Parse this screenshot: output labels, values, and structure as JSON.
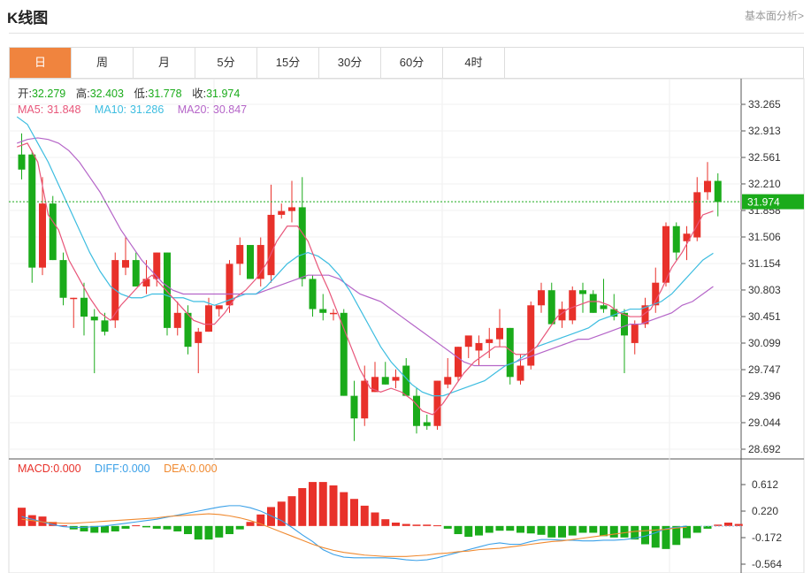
{
  "header": {
    "title": "K线图",
    "link": "基本面分析>"
  },
  "tabs": [
    "日",
    "周",
    "月",
    "5分",
    "15分",
    "30分",
    "60分",
    "4时"
  ],
  "active_tab": 0,
  "info": {
    "open_label": "开:",
    "open": "32.279",
    "high_label": "高:",
    "high": "32.403",
    "low_label": "低:",
    "low": "31.778",
    "close_label": "收:",
    "close": "31.974",
    "ma5_label": "MA5:",
    "ma5": "31.848",
    "ma10_label": "MA10:",
    "ma10": "31.286",
    "ma20_label": "MA20:",
    "ma20": "30.847"
  },
  "macd_info": {
    "macd_label": "MACD:",
    "macd": "0.000",
    "diff_label": "DIFF:",
    "diff": "0.000",
    "dea_label": "DEA:",
    "dea": "0.000"
  },
  "colors": {
    "up": "#e8312a",
    "down": "#1aab1a",
    "ma5": "#e8567a",
    "ma10": "#3dbde0",
    "ma20": "#b565c8",
    "diff": "#3aa0e8",
    "dea": "#f08a30",
    "active_tab": "#f0843e",
    "last_price": "#1aab1a"
  },
  "chart_data": [
    {
      "type": "candlestick",
      "y_ticks": [
        "33.265",
        "32.913",
        "32.561",
        "32.210",
        "31.858",
        "31.506",
        "31.154",
        "30.803",
        "30.451",
        "30.099",
        "29.747",
        "29.396",
        "29.044",
        "28.692"
      ],
      "ylim": [
        28.692,
        33.265
      ],
      "last_price": "31.974",
      "ohlc": [
        [
          32.6,
          32.88,
          32.27,
          32.4
        ],
        [
          32.6,
          32.65,
          30.9,
          31.1
        ],
        [
          31.1,
          32.3,
          31.0,
          31.95
        ],
        [
          31.95,
          32.05,
          31.2,
          31.2
        ],
        [
          31.2,
          31.3,
          30.6,
          30.7
        ],
        [
          30.7,
          30.7,
          30.3,
          30.7
        ],
        [
          30.7,
          30.9,
          30.2,
          30.45
        ],
        [
          30.45,
          30.55,
          29.7,
          30.4
        ],
        [
          30.4,
          30.5,
          30.2,
          30.25
        ],
        [
          30.4,
          31.3,
          30.3,
          31.2
        ],
        [
          31.1,
          31.5,
          31.0,
          31.2
        ],
        [
          31.2,
          31.3,
          30.85,
          30.85
        ],
        [
          30.85,
          31.2,
          30.75,
          30.95
        ],
        [
          30.95,
          31.3,
          30.85,
          31.3
        ],
        [
          31.3,
          31.3,
          30.2,
          30.3
        ],
        [
          30.3,
          30.65,
          30.2,
          30.5
        ],
        [
          30.5,
          30.6,
          29.95,
          30.05
        ],
        [
          30.1,
          30.3,
          29.7,
          30.25
        ],
        [
          30.25,
          30.7,
          30.25,
          30.6
        ],
        [
          30.55,
          30.6,
          30.45,
          30.6
        ],
        [
          30.6,
          31.2,
          30.5,
          31.15
        ],
        [
          31.15,
          31.5,
          31.0,
          31.4
        ],
        [
          31.4,
          31.4,
          30.95,
          30.95
        ],
        [
          30.95,
          31.5,
          30.85,
          31.4
        ],
        [
          31.0,
          32.2,
          30.9,
          31.8
        ],
        [
          31.8,
          31.95,
          31.75,
          31.85
        ],
        [
          31.85,
          32.25,
          31.7,
          31.9
        ],
        [
          31.9,
          32.3,
          30.85,
          30.95
        ],
        [
          30.95,
          31.0,
          30.45,
          30.55
        ],
        [
          30.55,
          30.75,
          30.4,
          30.5
        ],
        [
          30.5,
          30.55,
          30.4,
          30.5
        ],
        [
          30.5,
          30.55,
          29.4,
          29.4
        ],
        [
          29.4,
          29.6,
          28.8,
          29.1
        ],
        [
          29.1,
          29.8,
          29.0,
          29.6
        ],
        [
          29.45,
          29.85,
          29.45,
          29.65
        ],
        [
          29.65,
          29.85,
          29.55,
          29.55
        ],
        [
          29.6,
          29.75,
          29.5,
          29.65
        ],
        [
          29.8,
          29.9,
          29.4,
          29.4
        ],
        [
          29.4,
          29.5,
          28.9,
          29.0
        ],
        [
          29.05,
          29.15,
          28.95,
          29.0
        ],
        [
          29.0,
          29.6,
          28.95,
          29.6
        ],
        [
          29.55,
          29.9,
          29.5,
          29.65
        ],
        [
          29.65,
          30.05,
          29.6,
          30.05
        ],
        [
          30.05,
          30.15,
          29.9,
          30.2
        ],
        [
          30.0,
          30.2,
          29.8,
          30.1
        ],
        [
          30.1,
          30.3,
          29.9,
          30.15
        ],
        [
          30.15,
          30.55,
          30.05,
          30.3
        ],
        [
          30.3,
          30.3,
          29.55,
          29.65
        ],
        [
          29.6,
          29.95,
          29.55,
          29.8
        ],
        [
          29.8,
          30.65,
          29.75,
          30.6
        ],
        [
          30.6,
          30.9,
          30.5,
          30.8
        ],
        [
          30.8,
          30.9,
          30.35,
          30.35
        ],
        [
          30.4,
          30.65,
          30.3,
          30.55
        ],
        [
          30.4,
          30.85,
          30.35,
          30.8
        ],
        [
          30.8,
          30.9,
          30.5,
          30.75
        ],
        [
          30.75,
          30.8,
          30.5,
          30.5
        ],
        [
          30.6,
          30.95,
          30.5,
          30.55
        ],
        [
          30.55,
          30.75,
          30.4,
          30.45
        ],
        [
          30.5,
          30.55,
          29.7,
          30.2
        ],
        [
          30.1,
          30.4,
          29.95,
          30.35
        ],
        [
          30.35,
          30.7,
          30.3,
          30.6
        ],
        [
          30.6,
          31.1,
          30.5,
          30.9
        ],
        [
          30.9,
          31.7,
          30.85,
          31.65
        ],
        [
          31.65,
          31.7,
          31.2,
          31.3
        ],
        [
          31.45,
          31.65,
          31.2,
          31.55
        ],
        [
          31.5,
          32.3,
          31.45,
          32.1
        ],
        [
          32.1,
          32.5,
          32.0,
          32.25
        ],
        [
          32.25,
          32.35,
          31.78,
          31.97
        ]
      ],
      "ma5": [
        32.7,
        32.75,
        32.5,
        31.8,
        31.6,
        31.2,
        30.95,
        30.7,
        30.5,
        30.4,
        30.6,
        30.75,
        30.9,
        31.0,
        30.85,
        30.7,
        30.55,
        30.4,
        30.35,
        30.35,
        30.5,
        30.7,
        30.8,
        30.95,
        31.15,
        31.45,
        31.65,
        31.65,
        31.45,
        31.1,
        30.8,
        30.45,
        30.1,
        29.75,
        29.5,
        29.45,
        29.5,
        29.45,
        29.35,
        29.2,
        29.15,
        29.3,
        29.5,
        29.7,
        29.85,
        29.95,
        30.05,
        30.05,
        29.95,
        29.95,
        30.05,
        30.25,
        30.45,
        30.55,
        30.6,
        30.65,
        30.65,
        30.6,
        30.5,
        30.45,
        30.45,
        30.55,
        30.8,
        31.1,
        31.3,
        31.55,
        31.8,
        31.85
      ],
      "ma10": [
        33.1,
        33.0,
        32.75,
        32.5,
        32.2,
        31.9,
        31.6,
        31.3,
        31.05,
        30.85,
        30.75,
        30.7,
        30.7,
        30.75,
        30.75,
        30.7,
        30.7,
        30.65,
        30.65,
        30.6,
        30.65,
        30.7,
        30.75,
        30.75,
        30.85,
        31.0,
        31.15,
        31.25,
        31.3,
        31.25,
        31.15,
        31.0,
        30.8,
        30.55,
        30.3,
        30.05,
        29.85,
        29.7,
        29.55,
        29.45,
        29.4,
        29.4,
        29.45,
        29.5,
        29.55,
        29.6,
        29.7,
        29.8,
        29.85,
        29.95,
        30.05,
        30.1,
        30.15,
        30.2,
        30.25,
        30.3,
        30.4,
        30.45,
        30.5,
        30.55,
        30.55,
        30.6,
        30.65,
        30.75,
        30.9,
        31.05,
        31.2,
        31.29
      ],
      "ma20": [
        32.75,
        32.8,
        32.82,
        32.8,
        32.75,
        32.65,
        32.5,
        32.3,
        32.1,
        31.85,
        31.6,
        31.4,
        31.2,
        31.05,
        30.9,
        30.8,
        30.75,
        30.75,
        30.75,
        30.75,
        30.75,
        30.75,
        30.75,
        30.75,
        30.8,
        30.85,
        30.9,
        30.95,
        31.0,
        31.0,
        31.0,
        30.95,
        30.85,
        30.75,
        30.7,
        30.65,
        30.55,
        30.45,
        30.35,
        30.25,
        30.15,
        30.05,
        29.95,
        29.85,
        29.8,
        29.8,
        29.8,
        29.8,
        29.85,
        29.9,
        29.95,
        30.0,
        30.05,
        30.1,
        30.15,
        30.15,
        30.2,
        30.25,
        30.3,
        30.35,
        30.35,
        30.4,
        30.45,
        30.5,
        30.6,
        30.65,
        30.75,
        30.85
      ]
    },
    {
      "type": "bar",
      "name": "MACD",
      "y_ticks": [
        "0.612",
        "0.220",
        "-0.172",
        "-0.564"
      ],
      "ylim": [
        -0.564,
        0.612
      ],
      "macd": [
        0.27,
        0.16,
        0.14,
        0.06,
        0.01,
        -0.05,
        -0.08,
        -0.1,
        -0.1,
        -0.08,
        -0.04,
        0.01,
        -0.02,
        -0.04,
        -0.05,
        -0.08,
        -0.12,
        -0.2,
        -0.2,
        -0.17,
        -0.12,
        -0.05,
        0.06,
        0.17,
        0.28,
        0.36,
        0.44,
        0.56,
        0.65,
        0.65,
        0.6,
        0.5,
        0.4,
        0.3,
        0.2,
        0.1,
        0.05,
        0.03,
        0.02,
        0.02,
        0.01,
        -0.04,
        -0.12,
        -0.16,
        -0.14,
        -0.1,
        -0.07,
        -0.07,
        -0.1,
        -0.11,
        -0.13,
        -0.17,
        -0.17,
        -0.14,
        -0.1,
        -0.1,
        -0.15,
        -0.17,
        -0.17,
        -0.2,
        -0.27,
        -0.32,
        -0.34,
        -0.28,
        -0.18,
        -0.1,
        -0.04,
        0.02,
        0.05,
        0.03
      ],
      "diff": [
        0.14,
        0.1,
        0.06,
        0.02,
        -0.01,
        -0.02,
        -0.02,
        -0.01,
        0.0,
        0.02,
        0.04,
        0.06,
        0.08,
        0.1,
        0.13,
        0.16,
        0.19,
        0.22,
        0.25,
        0.28,
        0.3,
        0.3,
        0.27,
        0.22,
        0.15,
        0.08,
        -0.02,
        -0.13,
        -0.23,
        -0.35,
        -0.42,
        -0.46,
        -0.47,
        -0.47,
        -0.47,
        -0.47,
        -0.48,
        -0.5,
        -0.51,
        -0.5,
        -0.47,
        -0.43,
        -0.39,
        -0.35,
        -0.31,
        -0.27,
        -0.25,
        -0.27,
        -0.27,
        -0.23,
        -0.2,
        -0.2,
        -0.21,
        -0.21,
        -0.22,
        -0.22,
        -0.21,
        -0.21,
        -0.2,
        -0.18,
        -0.15,
        -0.1,
        -0.04,
        -0.02,
        0.0
      ],
      "dea": [
        0.1,
        0.08,
        0.06,
        0.05,
        0.04,
        0.04,
        0.05,
        0.06,
        0.07,
        0.08,
        0.09,
        0.1,
        0.11,
        0.12,
        0.14,
        0.15,
        0.16,
        0.17,
        0.18,
        0.17,
        0.15,
        0.12,
        0.08,
        0.03,
        -0.03,
        -0.09,
        -0.15,
        -0.21,
        -0.27,
        -0.32,
        -0.36,
        -0.39,
        -0.41,
        -0.43,
        -0.44,
        -0.45,
        -0.45,
        -0.45,
        -0.44,
        -0.43,
        -0.41,
        -0.4,
        -0.38,
        -0.37,
        -0.35,
        -0.34,
        -0.33,
        -0.31,
        -0.29,
        -0.27,
        -0.25,
        -0.23,
        -0.22,
        -0.2,
        -0.18,
        -0.16,
        -0.14,
        -0.12,
        -0.1,
        -0.08,
        -0.07,
        -0.06,
        -0.05,
        -0.03,
        -0.02
      ]
    }
  ]
}
